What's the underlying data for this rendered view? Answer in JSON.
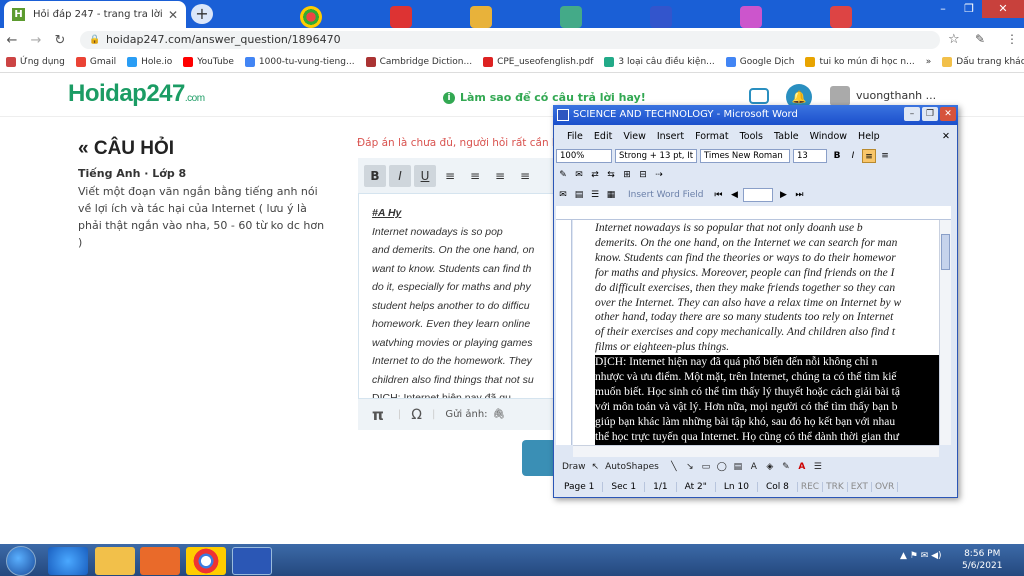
{
  "browser": {
    "tab_title": "Hỏi đáp 247 - trang tra lời",
    "url": "hoidap247.com/answer_question/1896470",
    "bookmarks": [
      "Ứng dụng",
      "Gmail",
      "Hole.io",
      "YouTube",
      "1000-tu-vung-tieng...",
      "Cambridge Diction...",
      "CPE_useofenglish.pdf",
      "3 loại câu điều kiện...",
      "Google Dịch",
      "tui ko mún đi học n...",
      "Dấu trang khác"
    ],
    "more_bookmarks": "»"
  },
  "site": {
    "logo": "Hoidap247",
    "logo_domain": ".com",
    "help_text": "Làm sao để có câu trả lời hay!",
    "username": "vuongthanh ..."
  },
  "question": {
    "header": "CÂU HỎI",
    "subject": "Tiếng Anh · Lớp 8",
    "text": "Viết một đoạn văn ngắn bằng tiếng anh nói về lợi ích và tác hại của Internet ( lưu ý là phải thật ngắn vào nha, 50 - 60 từ ko dc hơn )"
  },
  "answer": {
    "notice": "Đáp án là chưa đủ, người hỏi rất cần lời",
    "toolbar": [
      "B",
      "I",
      "U"
    ],
    "lines": [
      "#A Hy",
      "        Internet nowadays is so pop",
      "and demerits. On the one hand, on",
      "want to know. Students can find th",
      "do it, especially for maths and phy",
      "student helps another to do difficu",
      "homework. Even they learn online",
      "watvhing movies or playing games",
      "Internet to do the homework. They",
      "children also find things that not su",
      "     DỊCH: Internet hiện nay đã qu"
    ],
    "attach_label": "Gửi ảnh:",
    "pi": "π",
    "omega": "Ω"
  },
  "word": {
    "title": "SCIENCE AND TECHNOLOGY - Microsoft Word",
    "menu": [
      "File",
      "Edit",
      "View",
      "Insert",
      "Format",
      "Tools",
      "Table",
      "Window",
      "Help"
    ],
    "zoom": "100%",
    "style": "Strong + 13 pt, It",
    "font": "Times New Roman",
    "size": "13",
    "insert_field": "Insert Word Field",
    "lines_it": [
      "     Internet nowadays is so popular that not only doanh use b",
      "demerits. On the one hand, on the Internet we can search for man",
      "know. Students can find the theories or ways to do their homewor",
      "for maths and physics. Moreover, people can find friends on the I",
      "do difficult exercises, then they make friends together so they can",
      "over the Internet. They can also have a relax time on Internet by w",
      "other hand, today there are so many students too rely on Internet",
      "of their exercises and copy mechanically. And children also find t",
      "films or eighteen-plus things."
    ],
    "lines_sel": [
      "     DỊCH: Internet hiện nay đã quá phổ biến đến nỗi không chỉ n",
      "nhược và ưu điểm. Một mặt, trên Internet, chúng ta có thể tìm kiế",
      "muốn biết. Học sinh có thể tìm thấy lý thuyết hoặc cách giải bài tậ",
      "với môn toán và vật lý. Hơn nữa, mọi người có thể tìm thấy bạn b",
      "giúp bạn khác làm những bài tập khó, sau đó họ kết bạn với nhau",
      "thể học trực tuyến qua Internet. Họ cũng có thể dành thời gian thư"
    ],
    "draw": "Draw",
    "autoshapes": "AutoShapes",
    "status": [
      "Page 1",
      "Sec 1",
      "1/1",
      "At 2\"",
      "Ln 10",
      "Col 8"
    ],
    "status_dim": [
      "REC",
      "TRK",
      "EXT",
      "OVR"
    ]
  },
  "taskbar": {
    "time": "8:56 PM",
    "date": "5/6/2021"
  }
}
